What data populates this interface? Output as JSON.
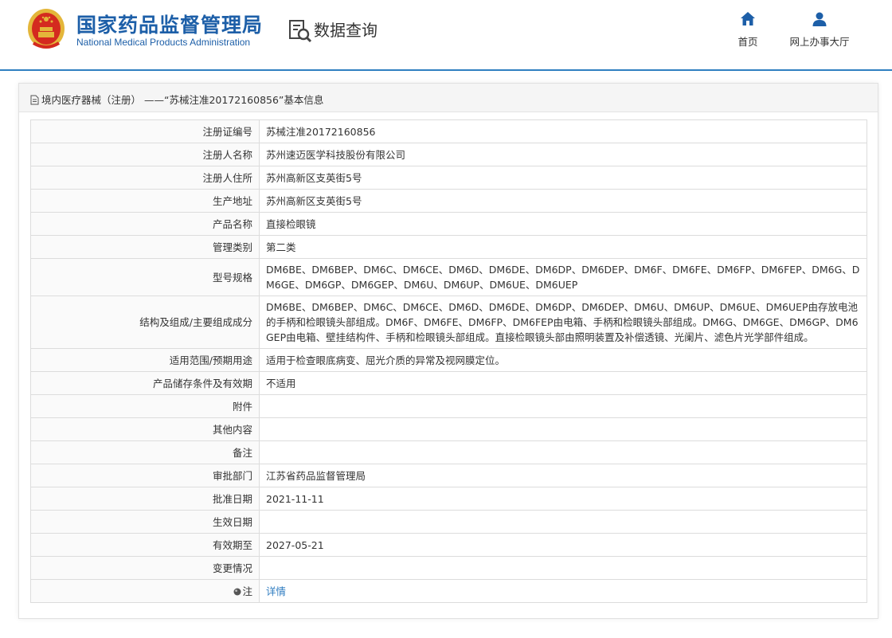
{
  "header": {
    "logo_cn": "国家药品监督管理局",
    "logo_en": "National Medical Products Administration",
    "query_label": "数据查询",
    "nav": [
      {
        "label": "首页",
        "icon": "home-icon"
      },
      {
        "label": "网上办事大厅",
        "icon": "user-icon"
      }
    ],
    "accent_color": "#1d5fa8"
  },
  "panel": {
    "title": "境内医疗器械（注册） ——“苏械注准20172160856”基本信息"
  },
  "rows": [
    {
      "key": "注册证编号",
      "value": "苏械注准20172160856"
    },
    {
      "key": "注册人名称",
      "value": "苏州速迈医学科技股份有限公司"
    },
    {
      "key": "注册人住所",
      "value": "苏州高新区支英街5号"
    },
    {
      "key": "生产地址",
      "value": "苏州高新区支英街5号"
    },
    {
      "key": "产品名称",
      "value": "直接检眼镜"
    },
    {
      "key": "管理类别",
      "value": "第二类"
    },
    {
      "key": "型号规格",
      "value": "DM6BE、DM6BEP、DM6C、DM6CE、DM6D、DM6DE、DM6DP、DM6DEP、DM6F、DM6FE、DM6FP、DM6FEP、DM6G、DM6GE、DM6GP、DM6GEP、DM6U、DM6UP、DM6UE、DM6UEP"
    },
    {
      "key": "结构及组成/主要组成成分",
      "value": "DM6BE、DM6BEP、DM6C、DM6CE、DM6D、DM6DE、DM6DP、DM6DEP、DM6U、DM6UP、DM6UE、DM6UEP由存放电池的手柄和检眼镜头部组成。DM6F、DM6FE、DM6FP、DM6FEP由电箱、手柄和检眼镜头部组成。DM6G、DM6GE、DM6GP、DM6GEP由电箱、壁挂结构件、手柄和检眼镜头部组成。直接检眼镜头部由照明装置及补偿透镜、光阑片、滤色片光学部件组成。"
    },
    {
      "key": "适用范围/预期用途",
      "value": "适用于检查眼底病变、屈光介质的异常及视网膜定位。"
    },
    {
      "key": "产品储存条件及有效期",
      "value": "不适用"
    },
    {
      "key": "附件",
      "value": ""
    },
    {
      "key": "其他内容",
      "value": ""
    },
    {
      "key": "备注",
      "value": ""
    },
    {
      "key": "审批部门",
      "value": "江苏省药品监督管理局"
    },
    {
      "key": "批准日期",
      "value": "2021-11-11"
    },
    {
      "key": "生效日期",
      "value": ""
    },
    {
      "key": "有效期至",
      "value": "2027-05-21"
    },
    {
      "key": "变更情况",
      "value": ""
    }
  ],
  "note_row": {
    "key": "注",
    "value": "详情"
  }
}
